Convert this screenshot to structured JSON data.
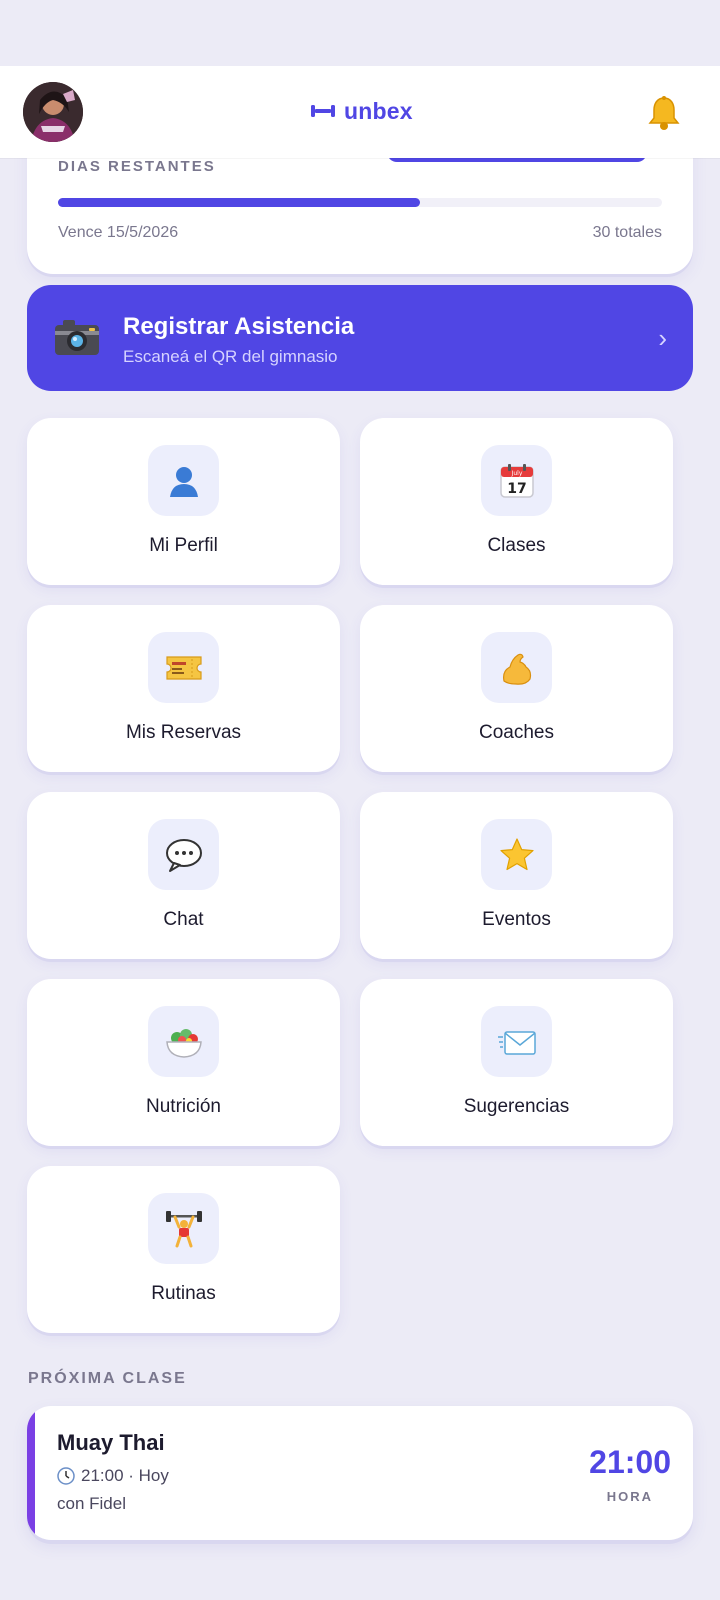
{
  "header": {
    "brand": "unbex",
    "colors": {
      "brand": "#5046e4",
      "background": "#ecebf6"
    }
  },
  "membership": {
    "label": "DIAS RESTANTES",
    "expires": "Vence 15/5/2026",
    "total": "30 totales",
    "progress_fraction": 0.6
  },
  "attendance": {
    "title": "Registrar Asistencia",
    "subtitle": "Escaneá el QR del gimnasio",
    "icon": "camera-icon"
  },
  "menu": [
    {
      "label": "Mi Perfil",
      "icon": "user-icon"
    },
    {
      "label": "Clases",
      "icon": "calendar-icon"
    },
    {
      "label": "Mis Reservas",
      "icon": "ticket-icon"
    },
    {
      "label": "Coaches",
      "icon": "flexed-biceps-icon"
    },
    {
      "label": "Chat",
      "icon": "speech-bubble-icon"
    },
    {
      "label": "Eventos",
      "icon": "star-icon"
    },
    {
      "label": "Nutrición",
      "icon": "salad-icon"
    },
    {
      "label": "Sugerencias",
      "icon": "envelope-icon"
    },
    {
      "label": "Rutinas",
      "icon": "weightlifter-icon"
    }
  ],
  "next_class": {
    "section_label": "PRÓXIMA CLASE",
    "name": "Muay Thai",
    "time_line": "21:00 · Hoy",
    "coach": "con Fidel",
    "time_big": "21:00",
    "time_caption": "HORA"
  }
}
